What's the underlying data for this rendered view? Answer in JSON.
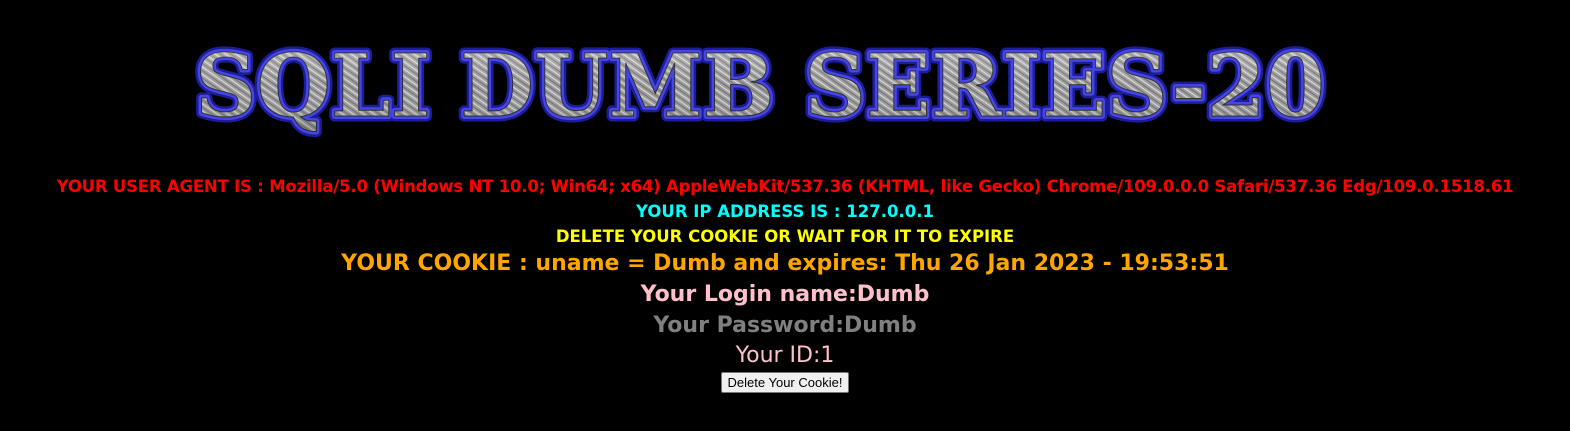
{
  "banner": {
    "title": "SQLI DUMB SERIES-20"
  },
  "info": {
    "user_agent": "YOUR USER AGENT IS : Mozilla/5.0 (Windows NT 10.0; Win64; x64) AppleWebKit/537.36 (KHTML, like Gecko) Chrome/109.0.0.0 Safari/537.36 Edg/109.0.1518.61",
    "ip_address": "YOUR IP ADDRESS IS : 127.0.0.1",
    "delete_note": "DELETE YOUR COOKIE OR WAIT FOR IT TO EXPIRE",
    "cookie": "YOUR COOKIE : uname = Dumb and expires: Thu 26 Jan 2023 - 19:53:51",
    "login_name": "Your Login name:Dumb",
    "password": "Your Password:Dumb",
    "user_id": "Your ID:1"
  },
  "actions": {
    "delete_cookie_label": "Delete Your Cookie!"
  },
  "colors": {
    "background": "#000000",
    "user_agent": "#ff0000",
    "ip_address": "#00ffff",
    "delete_note": "#ffff00",
    "cookie": "#ffa500",
    "login_name": "#ffc0cb",
    "password": "#808080",
    "user_id": "#ffc0cb",
    "banner_outline": "#2a2ad0",
    "banner_fill": "#a8a8a8"
  }
}
